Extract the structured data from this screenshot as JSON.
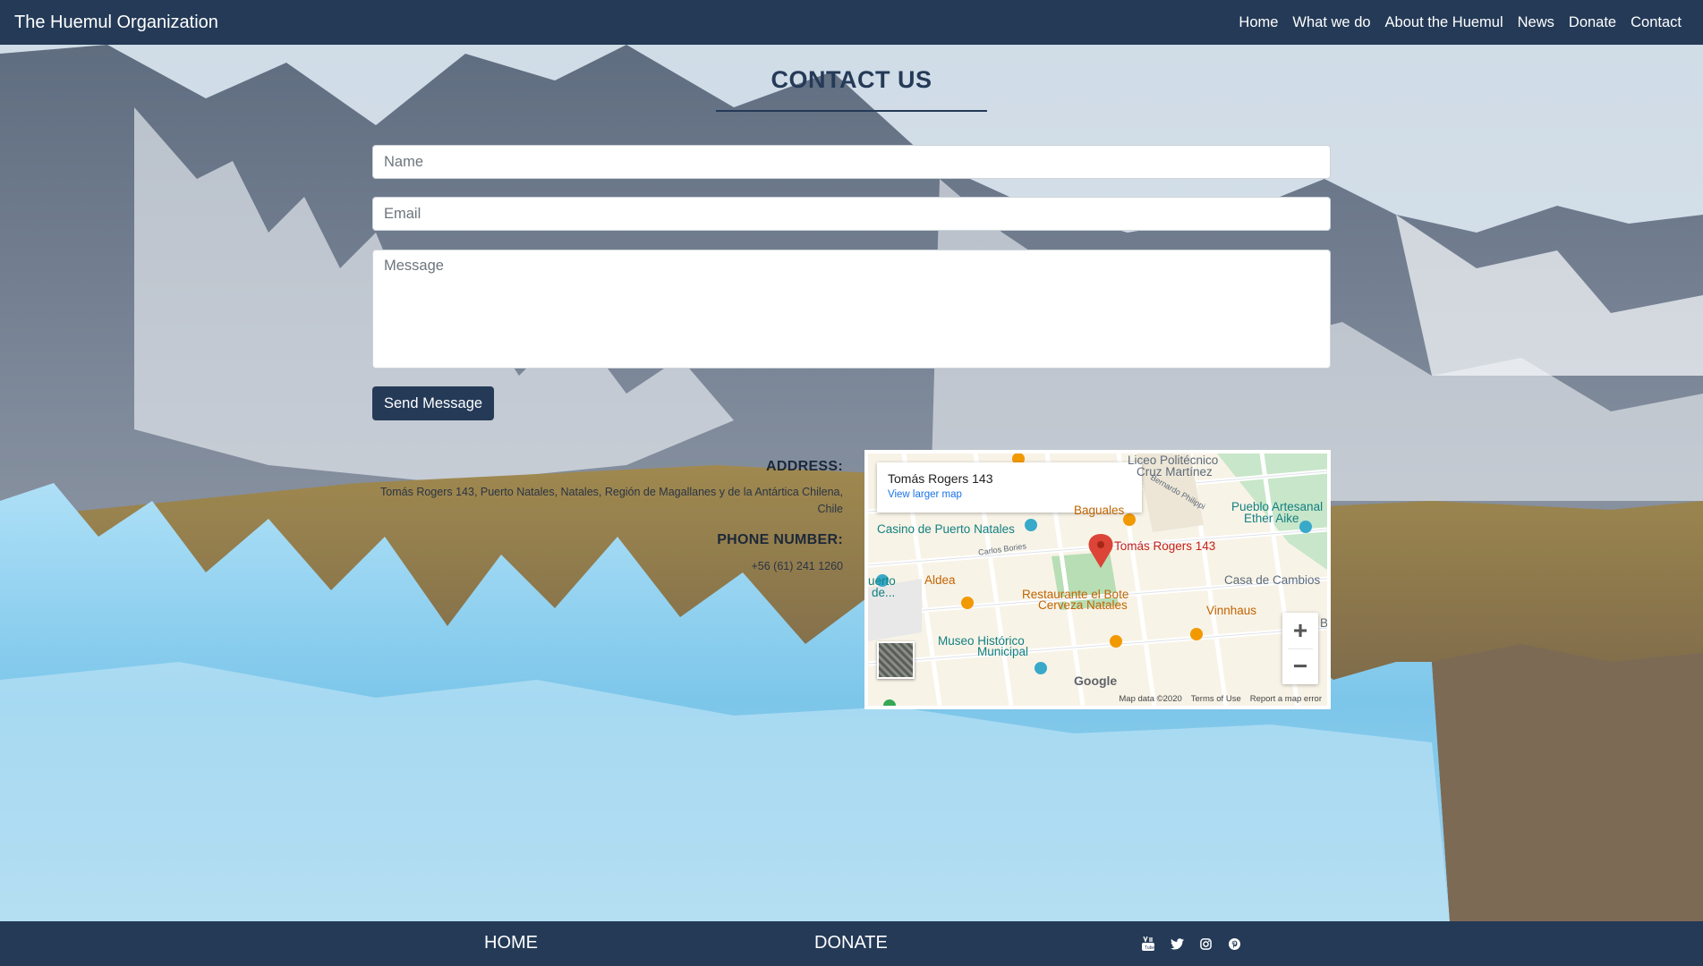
{
  "navbar": {
    "brand": "The Huemul Organization",
    "links": [
      "Home",
      "What we do",
      "About the Huemul",
      "News",
      "Donate",
      "Contact"
    ]
  },
  "page": {
    "title": "CONTACT US"
  },
  "form": {
    "name_placeholder": "Name",
    "email_placeholder": "Email",
    "message_placeholder": "Message",
    "send_label": "Send Message"
  },
  "contact": {
    "address_label": "ADDRESS:",
    "address_value": "Tomás Rogers 143, Puerto Natales, Natales, Región de Magallanes y de la Antártica Chilena, Chile",
    "phone_label": "PHONE NUMBER:",
    "phone_value": "+56 (61) 241 1260"
  },
  "map": {
    "card_title": "Tomás Rogers 143",
    "card_link": "View larger map",
    "pin_label": "Tomás Rogers 143",
    "labels": {
      "liceo": "Liceo Politécnico",
      "cruz": "Cruz Martínez",
      "bernardo": "Bernardo Philippi",
      "baguales": "Baguales",
      "pueblo1": "Pueblo Artesanal",
      "pueblo2": "Ether Aike",
      "casino": "Casino de Puerto Natales",
      "carlos": "Carlos Bories",
      "puerto1": "uerto",
      "puerto2": "de...",
      "aldea": "Aldea",
      "casa": "Casa de Cambios",
      "rest1": "Restaurante el Bote",
      "rest2": "Cerveza Natales",
      "vinnhaus": "Vinnhaus",
      "museo1": "Museo Histórico",
      "museo2": "Municipal",
      "b": "B",
      "google": "Google",
      "map_data": "Map data ©2020",
      "terms": "Terms of Use",
      "report": "Report a map error"
    },
    "zoom_in": "+",
    "zoom_out": "−"
  },
  "footer": {
    "home": "HOME",
    "donate": "DONATE",
    "socials": [
      "youtube-icon",
      "twitter-icon",
      "instagram-icon",
      "pinterest-icon"
    ]
  },
  "colors": {
    "navy": "#243a57",
    "ice": "#8ec9ec",
    "pin": "#db4437"
  }
}
